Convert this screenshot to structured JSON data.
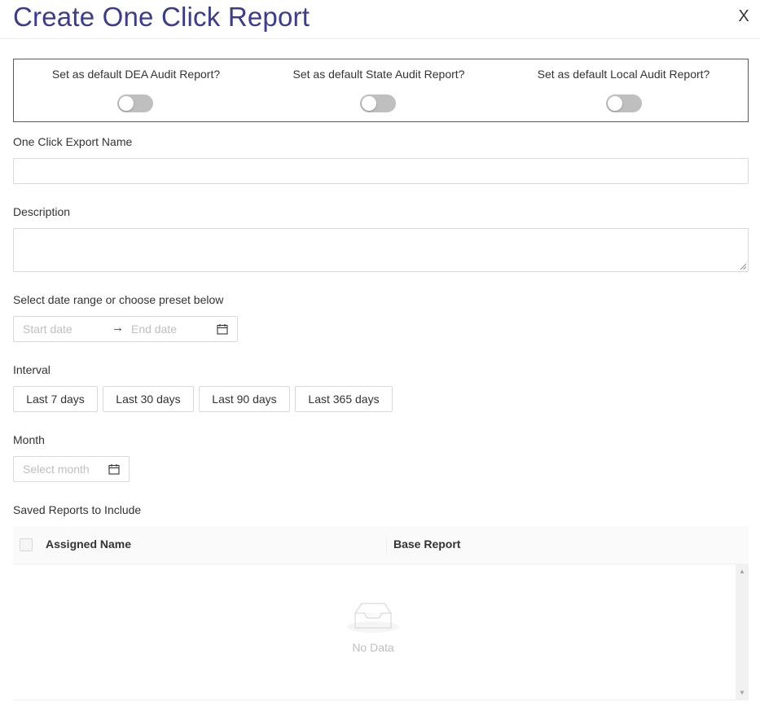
{
  "dialog": {
    "title": "Create One Click Report",
    "close_label": "X"
  },
  "defaults": {
    "dea_label": "Set as default DEA Audit Report?",
    "state_label": "Set as default State Audit Report?",
    "local_label": "Set as default Local Audit Report?",
    "dea_on": false,
    "state_on": false,
    "local_on": false
  },
  "form": {
    "export_name_label": "One Click Export Name",
    "export_name_value": "",
    "description_label": "Description",
    "description_value": "",
    "date_range_label": "Select date range or choose preset below",
    "start_placeholder": "Start date",
    "range_arrow": "→",
    "end_placeholder": "End date",
    "interval_label": "Interval",
    "interval_options": [
      "Last 7 days",
      "Last 30 days",
      "Last 90 days",
      "Last 365 days"
    ],
    "month_label": "Month",
    "month_placeholder": "Select month"
  },
  "saved_reports": {
    "label": "Saved Reports to Include",
    "columns": [
      "Assigned Name",
      "Base Report"
    ],
    "rows": [],
    "empty_text": "No Data"
  },
  "colors": {
    "title": "#3b3b8f",
    "border": "#d9d9d9",
    "switch_off": "#bfbfbf"
  },
  "icons": {
    "close": "close-icon",
    "calendar": "calendar-icon",
    "empty": "empty-inbox-icon"
  }
}
